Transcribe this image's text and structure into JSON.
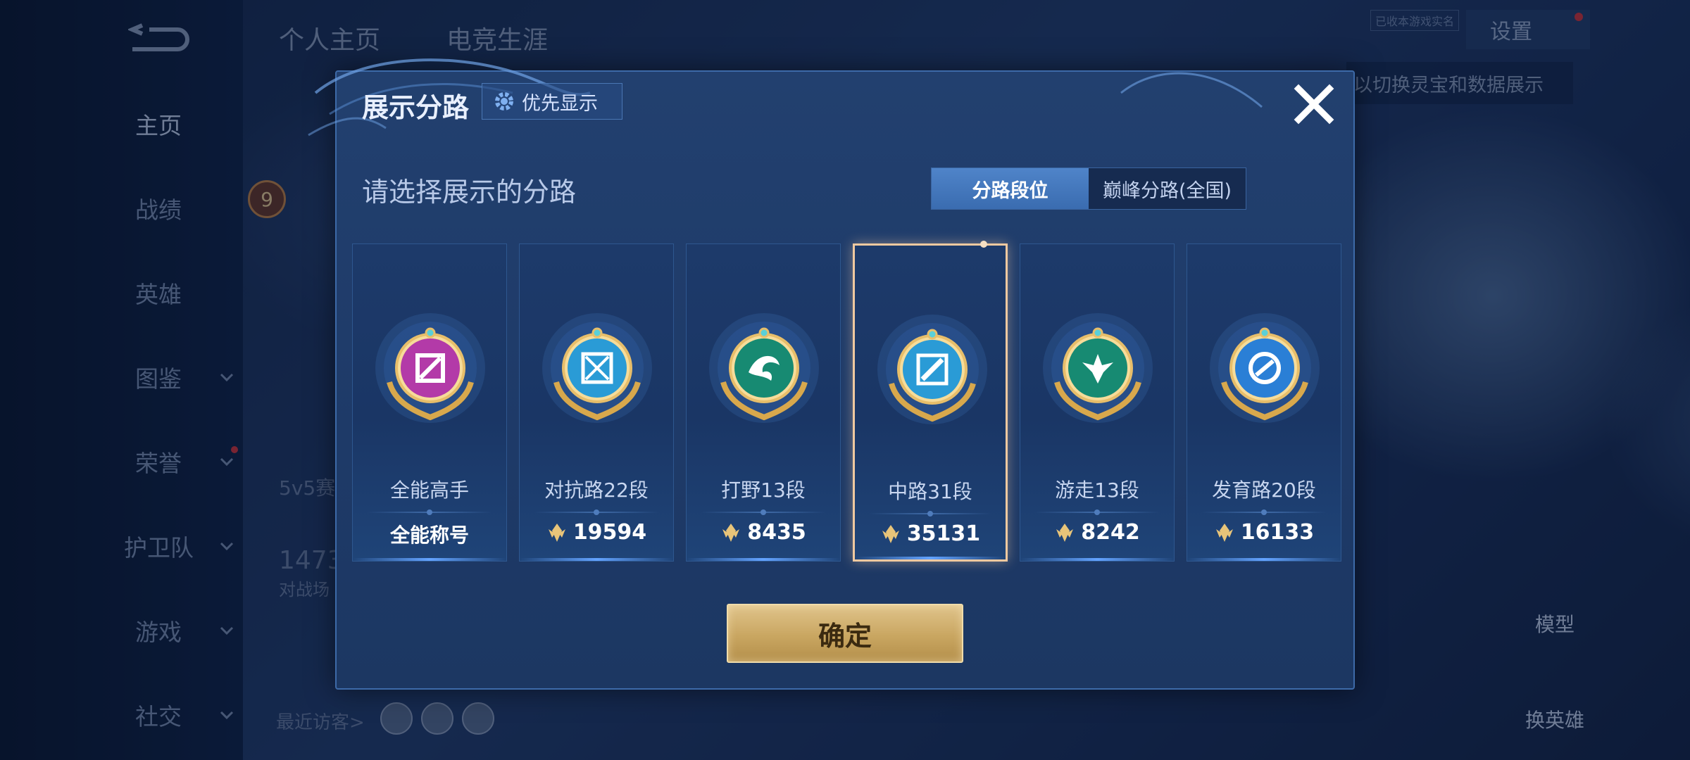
{
  "background": {
    "top_tabs": [
      "个人主页",
      "电竞生涯"
    ],
    "nav_items": [
      {
        "label": "主页",
        "active": true,
        "chevron": false,
        "dot": false
      },
      {
        "label": "战绩",
        "active": false,
        "chevron": false,
        "dot": false
      },
      {
        "label": "英雄",
        "active": false,
        "chevron": false,
        "dot": false
      },
      {
        "label": "图鉴",
        "active": false,
        "chevron": true,
        "dot": false
      },
      {
        "label": "荣誉",
        "active": false,
        "chevron": true,
        "dot": true
      },
      {
        "label": "护卫队",
        "active": false,
        "chevron": true,
        "dot": false
      },
      {
        "label": "游戏",
        "active": false,
        "chevron": true,
        "dot": false
      },
      {
        "label": "社交",
        "active": false,
        "chevron": true,
        "dot": false
      }
    ],
    "level_badge": "9",
    "mode_text": "5v5赛",
    "score_text": "1473",
    "battle_text": "对战场",
    "recent_visitors_label": "最近访客>",
    "settings_label": "设置",
    "tip_text": "以切换灵宝和数据展示",
    "small_tag": "已收本游戏实名",
    "model_label": "模型",
    "swap_hero_label": "换英雄"
  },
  "modal": {
    "title": "展示分路",
    "priority_label": "优先显示",
    "subtitle": "请选择展示的分路",
    "toggle": {
      "options": [
        "分路段位",
        "巅峰分路(全国)"
      ],
      "selected": 0
    },
    "cards": [
      {
        "name": "全能高手",
        "stat_text": "全能称号",
        "points": null,
        "badge": "allround-badge-icon",
        "color": "#b33aa8",
        "selected": false
      },
      {
        "name": "对抗路22段",
        "stat_text": null,
        "points": "19594",
        "badge": "clash-lane-badge-icon",
        "color": "#2a9bd6",
        "selected": false
      },
      {
        "name": "打野13段",
        "stat_text": null,
        "points": "8435",
        "badge": "jungle-badge-icon",
        "color": "#178a72",
        "selected": false
      },
      {
        "name": "中路31段",
        "stat_text": null,
        "points": "35131",
        "badge": "mid-lane-badge-icon",
        "color": "#2a9bd6",
        "selected": true
      },
      {
        "name": "游走13段",
        "stat_text": null,
        "points": "8242",
        "badge": "roam-badge-icon",
        "color": "#178a72",
        "selected": false
      },
      {
        "name": "发育路20段",
        "stat_text": null,
        "points": "16133",
        "badge": "farm-lane-badge-icon",
        "color": "#2a7fd6",
        "selected": false
      }
    ],
    "confirm_label": "确定"
  },
  "colors": {
    "accent_gold": "#c9a661",
    "selected_border": "#f0c9a0",
    "toggle_active": "#4f84c9"
  }
}
